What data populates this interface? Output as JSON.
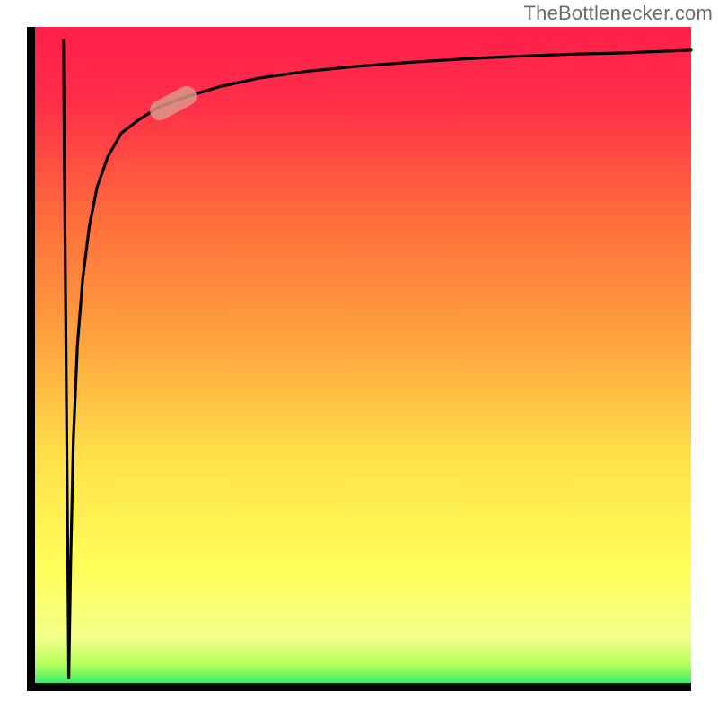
{
  "watermark": {
    "text": "TheBottlenecker.com"
  },
  "chart_data": {
    "type": "line",
    "title": "",
    "xlabel": "",
    "ylabel": "",
    "xlim": [
      0,
      100
    ],
    "ylim": [
      0,
      100
    ],
    "gradient_stops": [
      {
        "offset": 0,
        "color": "#00e676"
      },
      {
        "offset": 4,
        "color": "#b6ff59"
      },
      {
        "offset": 8,
        "color": "#f2ff8a"
      },
      {
        "offset": 18,
        "color": "#ffff5a"
      },
      {
        "offset": 35,
        "color": "#ffe24a"
      },
      {
        "offset": 52,
        "color": "#ffa53e"
      },
      {
        "offset": 72,
        "color": "#ff6a3c"
      },
      {
        "offset": 88,
        "color": "#ff2f49"
      },
      {
        "offset": 100,
        "color": "#ff1f4a"
      }
    ],
    "series": [
      {
        "name": "down-stroke",
        "x": [
          5.5,
          6.3
        ],
        "y": [
          98,
          2
        ]
      },
      {
        "name": "up-curve",
        "x": [
          6.3,
          6.6,
          7.0,
          7.6,
          8.4,
          9.4,
          10.6,
          12.2,
          14.2,
          16.8,
          20.0,
          24.0,
          29.0,
          35.0,
          42.0,
          50.0,
          58.0,
          66.0,
          74.0,
          82.0,
          90.0,
          100.0
        ],
        "y": [
          2,
          20,
          38,
          52,
          62,
          70,
          76,
          80.5,
          84,
          86,
          88,
          89.5,
          91,
          92.3,
          93.3,
          94.1,
          94.7,
          95.2,
          95.6,
          95.9,
          96.1,
          96.5
        ]
      }
    ],
    "marker": {
      "x": 22,
      "y": 88.5,
      "angle_deg": -28
    }
  }
}
